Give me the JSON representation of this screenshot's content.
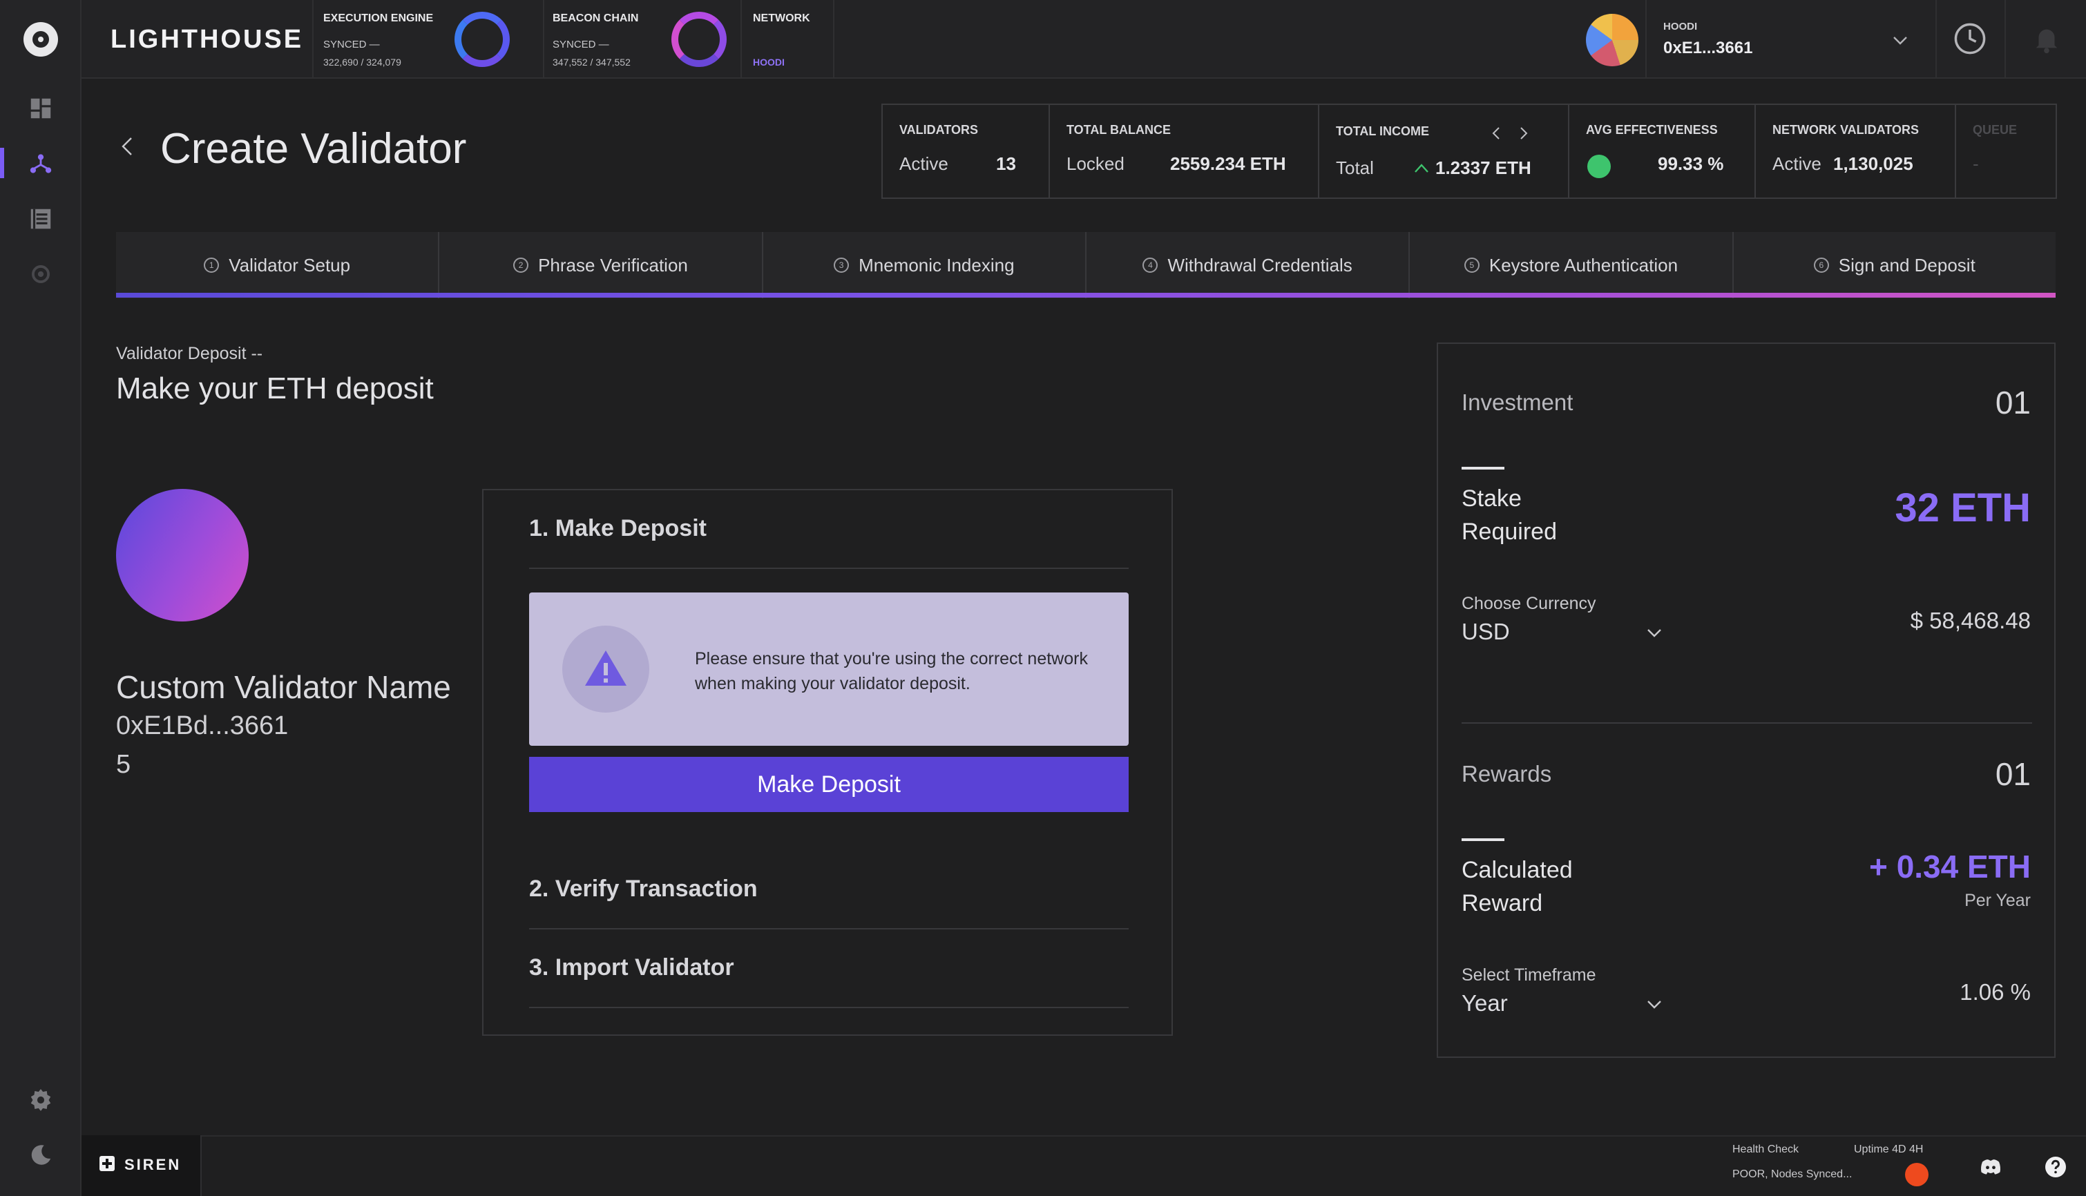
{
  "brand": "LIGHTHOUSE",
  "nodes": {
    "execution": {
      "title": "EXECUTION ENGINE",
      "status": "SYNCED —",
      "count": "322,690 / 324,079"
    },
    "beacon": {
      "title": "BEACON CHAIN",
      "status": "SYNCED —",
      "count": "347,552 / 347,552"
    },
    "network": {
      "title": "NETWORK",
      "value": "HOODI"
    }
  },
  "account": {
    "network": "HOODI",
    "address": "0xE1...3661"
  },
  "page": {
    "title": "Create Validator"
  },
  "stats": {
    "validators": {
      "label": "VALIDATORS",
      "a": "Active",
      "b": "13"
    },
    "balance": {
      "label": "TOTAL BALANCE",
      "a": "Locked",
      "b": "2559.234 ETH"
    },
    "income": {
      "label": "TOTAL INCOME",
      "a": "Total",
      "b": "1.2337 ETH"
    },
    "effectiveness": {
      "label": "AVG EFFECTIVENESS",
      "b": "99.33 %"
    },
    "network_validators": {
      "label": "NETWORK VALIDATORS",
      "a": "Active",
      "b": "1,130,025"
    },
    "queue": {
      "label": "QUEUE",
      "a": "-"
    }
  },
  "steps": [
    {
      "num": "1",
      "label": "Validator Setup"
    },
    {
      "num": "2",
      "label": "Phrase Verification"
    },
    {
      "num": "3",
      "label": "Mnemonic Indexing"
    },
    {
      "num": "4",
      "label": "Withdrawal Credentials"
    },
    {
      "num": "5",
      "label": "Keystore Authentication"
    },
    {
      "num": "6",
      "label": "Sign and Deposit"
    }
  ],
  "deposit": {
    "kicker": "Validator Deposit --",
    "title": "Make your ETH deposit",
    "validator_name": "Custom Validator Name",
    "validator_address": "0xE1Bd...3661",
    "validator_index": "5",
    "step1": "1. Make Deposit",
    "warning": "Please ensure that you're using the correct network when making your validator deposit.",
    "button": "Make Deposit",
    "step2": "2. Verify Transaction",
    "step3": "3. Import Validator"
  },
  "panel": {
    "investment": {
      "title": "Investment",
      "count": "01",
      "label": "Stake Required",
      "value": "32 ETH",
      "currency_label": "Choose Currency",
      "currency": "USD",
      "fiat": "$ 58,468.48"
    },
    "rewards": {
      "title": "Rewards",
      "count": "01",
      "label": "Calculated Reward",
      "value": "+ 0.34 ETH",
      "per": "Per Year",
      "timeframe_label": "Select Timeframe",
      "timeframe": "Year",
      "rate": "1.06 %"
    }
  },
  "footer": {
    "siren": "SIREN",
    "health_label": "Health Check",
    "health_value": "POOR, Nodes Synced...",
    "uptime": "Uptime 4D 4H"
  },
  "colors": {
    "accent": "#5a42d6",
    "accent_light": "#8a6cf5",
    "health_poor": "#ee4a1e",
    "effectiveness_ok": "#3ec46d"
  }
}
